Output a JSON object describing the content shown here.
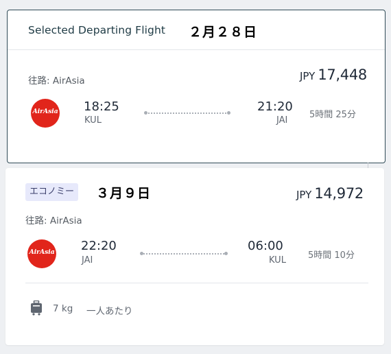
{
  "colors": {
    "airasia_red": "#e1251b",
    "selected_border": "#2f4a56",
    "badge_bg": "#e7e9fb"
  },
  "departing": {
    "header_title": "Selected Departing Flight",
    "date_note": "２月２８日",
    "route_label": "往路: AirAsia",
    "price_currency": "JPY",
    "price_amount": "17,448",
    "airline_logo_text": "AirAsia",
    "depart_time": "18:25",
    "depart_code": "KUL",
    "arrive_time": "21:20",
    "arrive_code": "JAI",
    "duration": "5時間 25分"
  },
  "returning": {
    "cabin_badge": "エコノミー",
    "date_note": "３月９日",
    "price_currency": "JPY",
    "price_amount": "14,972",
    "route_label": "往路: AirAsia",
    "airline_logo_text": "AirAsia",
    "depart_time": "22:20",
    "depart_code": "JAI",
    "arrive_time": "06:00",
    "arrive_code": "KUL",
    "duration": "5時間 10分",
    "baggage_icon": "luggage-icon",
    "baggage_weight": "7 kg",
    "baggage_note": "一人あたり"
  }
}
